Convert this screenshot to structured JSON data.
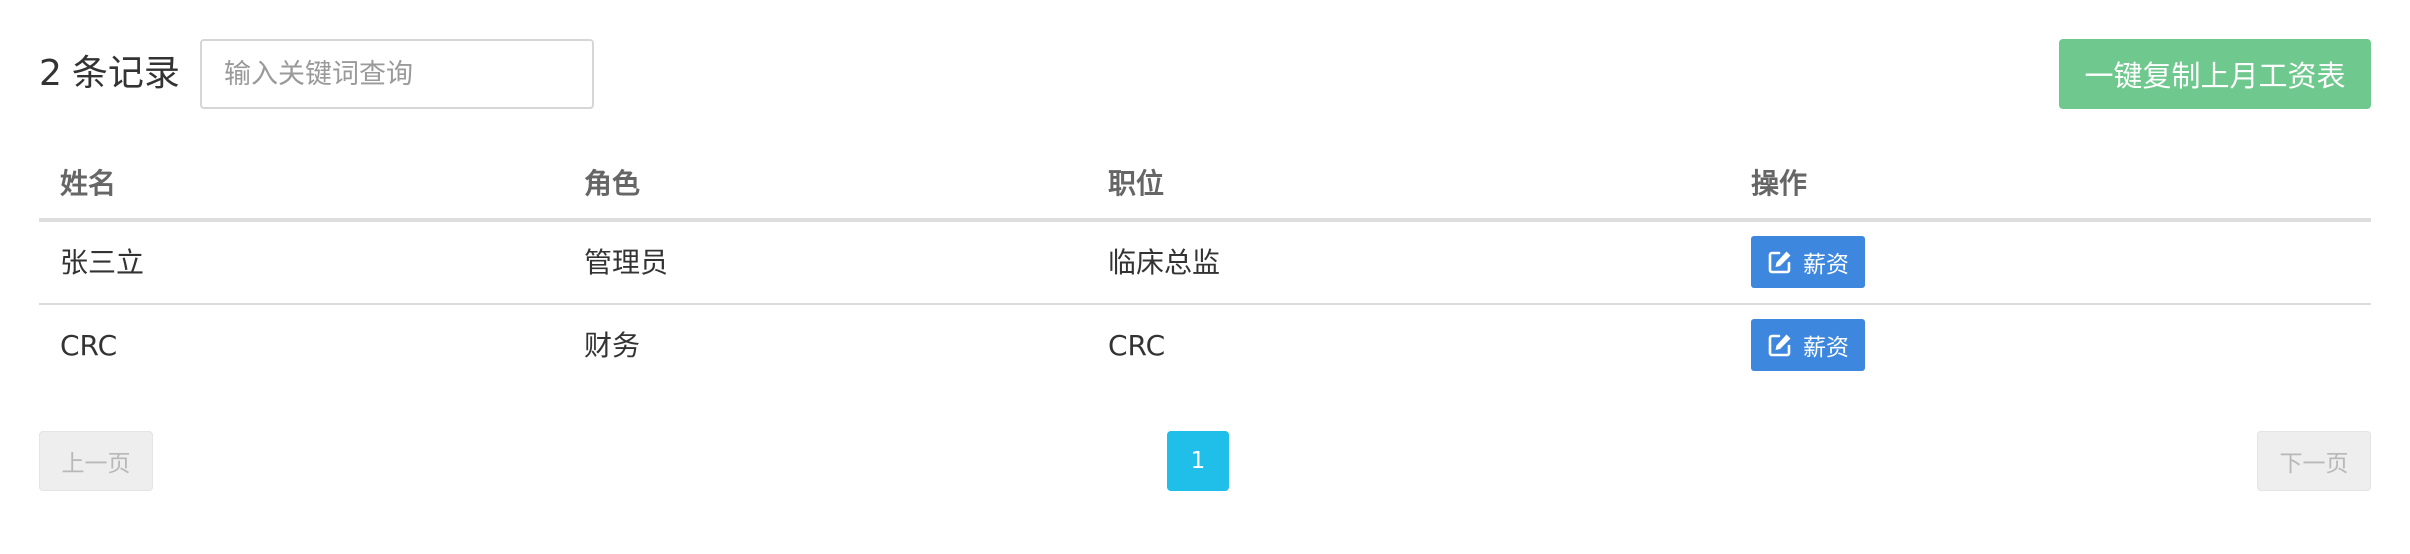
{
  "header": {
    "record_count": "2",
    "record_suffix": "条记录",
    "search_placeholder": "输入关键词查询",
    "copy_button_label": "一键复制上月工资表"
  },
  "table": {
    "columns": [
      "姓名",
      "角色",
      "职位",
      "操作"
    ],
    "rows": [
      {
        "name": "张三立",
        "role": "管理员",
        "position": "临床总监",
        "action_label": "薪资",
        "action_icon": "edit-icon"
      },
      {
        "name": "CRC",
        "role": "财务",
        "position": "CRC",
        "action_label": "薪资",
        "action_icon": "edit-icon"
      }
    ]
  },
  "pagination": {
    "prev_label": "上一页",
    "current_page": "1",
    "next_label": "下一页"
  },
  "colors": {
    "copy_button": "#6fc88d",
    "action_button": "#3d87de",
    "current_page": "#1fbfe9",
    "pager_disabled_bg": "#eeeeee"
  }
}
